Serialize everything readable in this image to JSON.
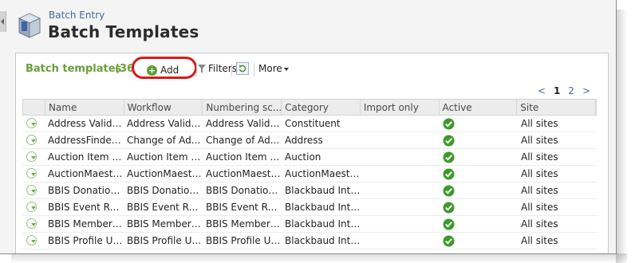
{
  "header": {
    "breadcrumb": "Batch Entry",
    "title": "Batch Templates",
    "icon": "batch-box-icon"
  },
  "panel": {
    "title": "Batch templates",
    "count": "(36",
    "toolbar": {
      "add_label": "Add",
      "filters_label": "Filters",
      "more_label": "More",
      "highlight_color": "#d81a1a"
    },
    "pager": {
      "prev": "<",
      "pages": [
        "1",
        "2"
      ],
      "next": ">"
    }
  },
  "table": {
    "columns": [
      "Name",
      "Workflow",
      "Numbering sc...",
      "Category",
      "Import only",
      "Active",
      "Site"
    ],
    "rows": [
      {
        "name": "Address Valida...",
        "workflow": "Address Valida...",
        "numbering": "Address Valida...",
        "category": "Constituent",
        "import_only": "",
        "active": true,
        "site": "All sites"
      },
      {
        "name": "AddressFinder ...",
        "workflow": "Change of Ad...",
        "numbering": "Change of Ad...",
        "category": "Address",
        "import_only": "",
        "active": true,
        "site": "All sites"
      },
      {
        "name": "Auction Item B...",
        "workflow": "Auction Item B...",
        "numbering": "Auction Item B...",
        "category": "Auction",
        "import_only": "",
        "active": true,
        "site": "All sites"
      },
      {
        "name": "AuctionMaestr...",
        "workflow": "AuctionMaestr...",
        "numbering": "AuctionMaestr...",
        "category": "AuctionMaestr...",
        "import_only": "",
        "active": true,
        "site": "All sites"
      },
      {
        "name": "BBIS Donation ...",
        "workflow": "BBIS Donation ...",
        "numbering": "BBIS Donation ...",
        "category": "Blackbaud Inte...",
        "import_only": "",
        "active": true,
        "site": "All sites"
      },
      {
        "name": "BBIS Event Reg...",
        "workflow": "BBIS Event Reg...",
        "numbering": "BBIS Event Reg...",
        "category": "Blackbaud Inte...",
        "import_only": "",
        "active": true,
        "site": "All sites"
      },
      {
        "name": "BBIS Members...",
        "workflow": "BBIS Members...",
        "numbering": "BBIS Members...",
        "category": "Blackbaud Inte...",
        "import_only": "",
        "active": true,
        "site": "All sites"
      },
      {
        "name": "BBIS Profile Up...",
        "workflow": "BBIS Profile Up...",
        "numbering": "BBIS Profile Up...",
        "category": "Blackbaud Inte...",
        "import_only": "",
        "active": true,
        "site": "All sites"
      }
    ]
  },
  "colors": {
    "panel_title": "#6a9f3a",
    "link": "#3f6d9c",
    "active_check": "#3d9a2a"
  }
}
